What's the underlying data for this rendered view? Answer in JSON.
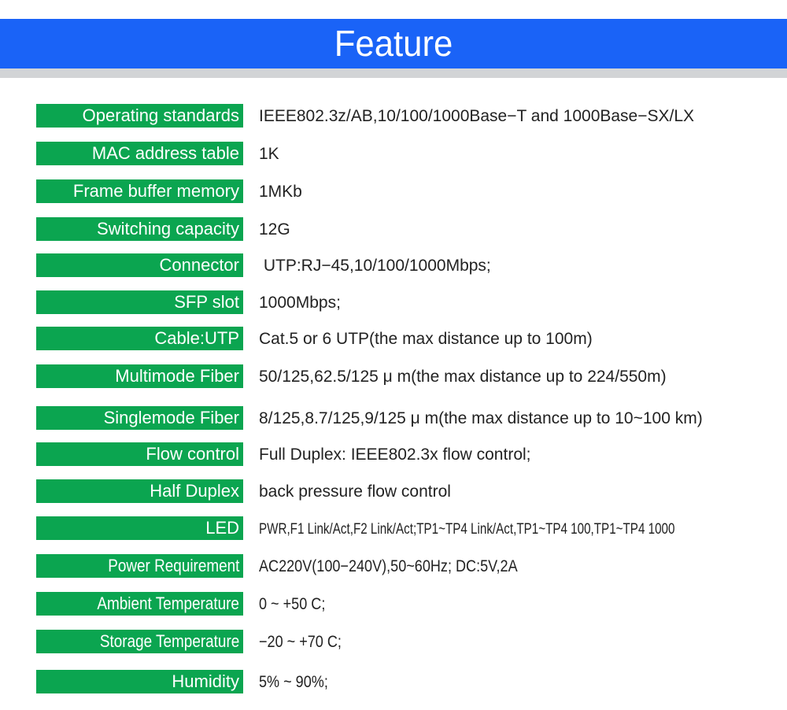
{
  "header": {
    "title": "Feature",
    "colors": {
      "bar": "#1a63f7",
      "shadow": "#d2d4d6",
      "label_bg": "#0ba550",
      "label_text": "#ffffff",
      "value_text": "#222222"
    }
  },
  "specs": [
    {
      "label": "Operating standards",
      "value": "IEEE802.3z/AB,10/100/1000Base−T and 1000Base−SX/LX"
    },
    {
      "label": "MAC address table",
      "value": "1K"
    },
    {
      "label": "Frame buffer memory",
      "value": "1MKb"
    },
    {
      "label": "Switching capacity",
      "value": "12G"
    },
    {
      "label": "Connector",
      "value": " UTP:RJ−45,10/100/1000Mbps;"
    },
    {
      "label": "SFP slot",
      "value": "1000Mbps;"
    },
    {
      "label": "Cable:UTP",
      "value": "Cat.5 or 6 UTP(the max distance up to 100m)"
    },
    {
      "label": "Multimode Fiber",
      "value": "50/125,62.5/125 μ m(the max distance up to 224/550m)"
    },
    {
      "label": "Singlemode Fiber",
      "value": "8/125,8.7/125,9/125 μ m(the max distance up to 10~100 km)"
    },
    {
      "label": "Flow control",
      "value": "Full Duplex: IEEE802.3x flow control;"
    },
    {
      "label": "Half Duplex",
      "value": "back pressure flow control"
    },
    {
      "label": "LED",
      "value": "PWR,F1 Link/Act,F2 Link/Act;TP1~TP4 Link/Act,TP1~TP4 100,TP1~TP4 1000"
    },
    {
      "label": "Power Requirement",
      "value": "AC220V(100−240V),50~60Hz; DC:5V,2A"
    },
    {
      "label": "Ambient Temperature",
      "value": "0 ~ +50 C;"
    },
    {
      "label": "Storage Temperature",
      "value": "−20 ~ +70 C;"
    },
    {
      "label": "Humidity",
      "value": "5% ~ 90%;"
    }
  ]
}
